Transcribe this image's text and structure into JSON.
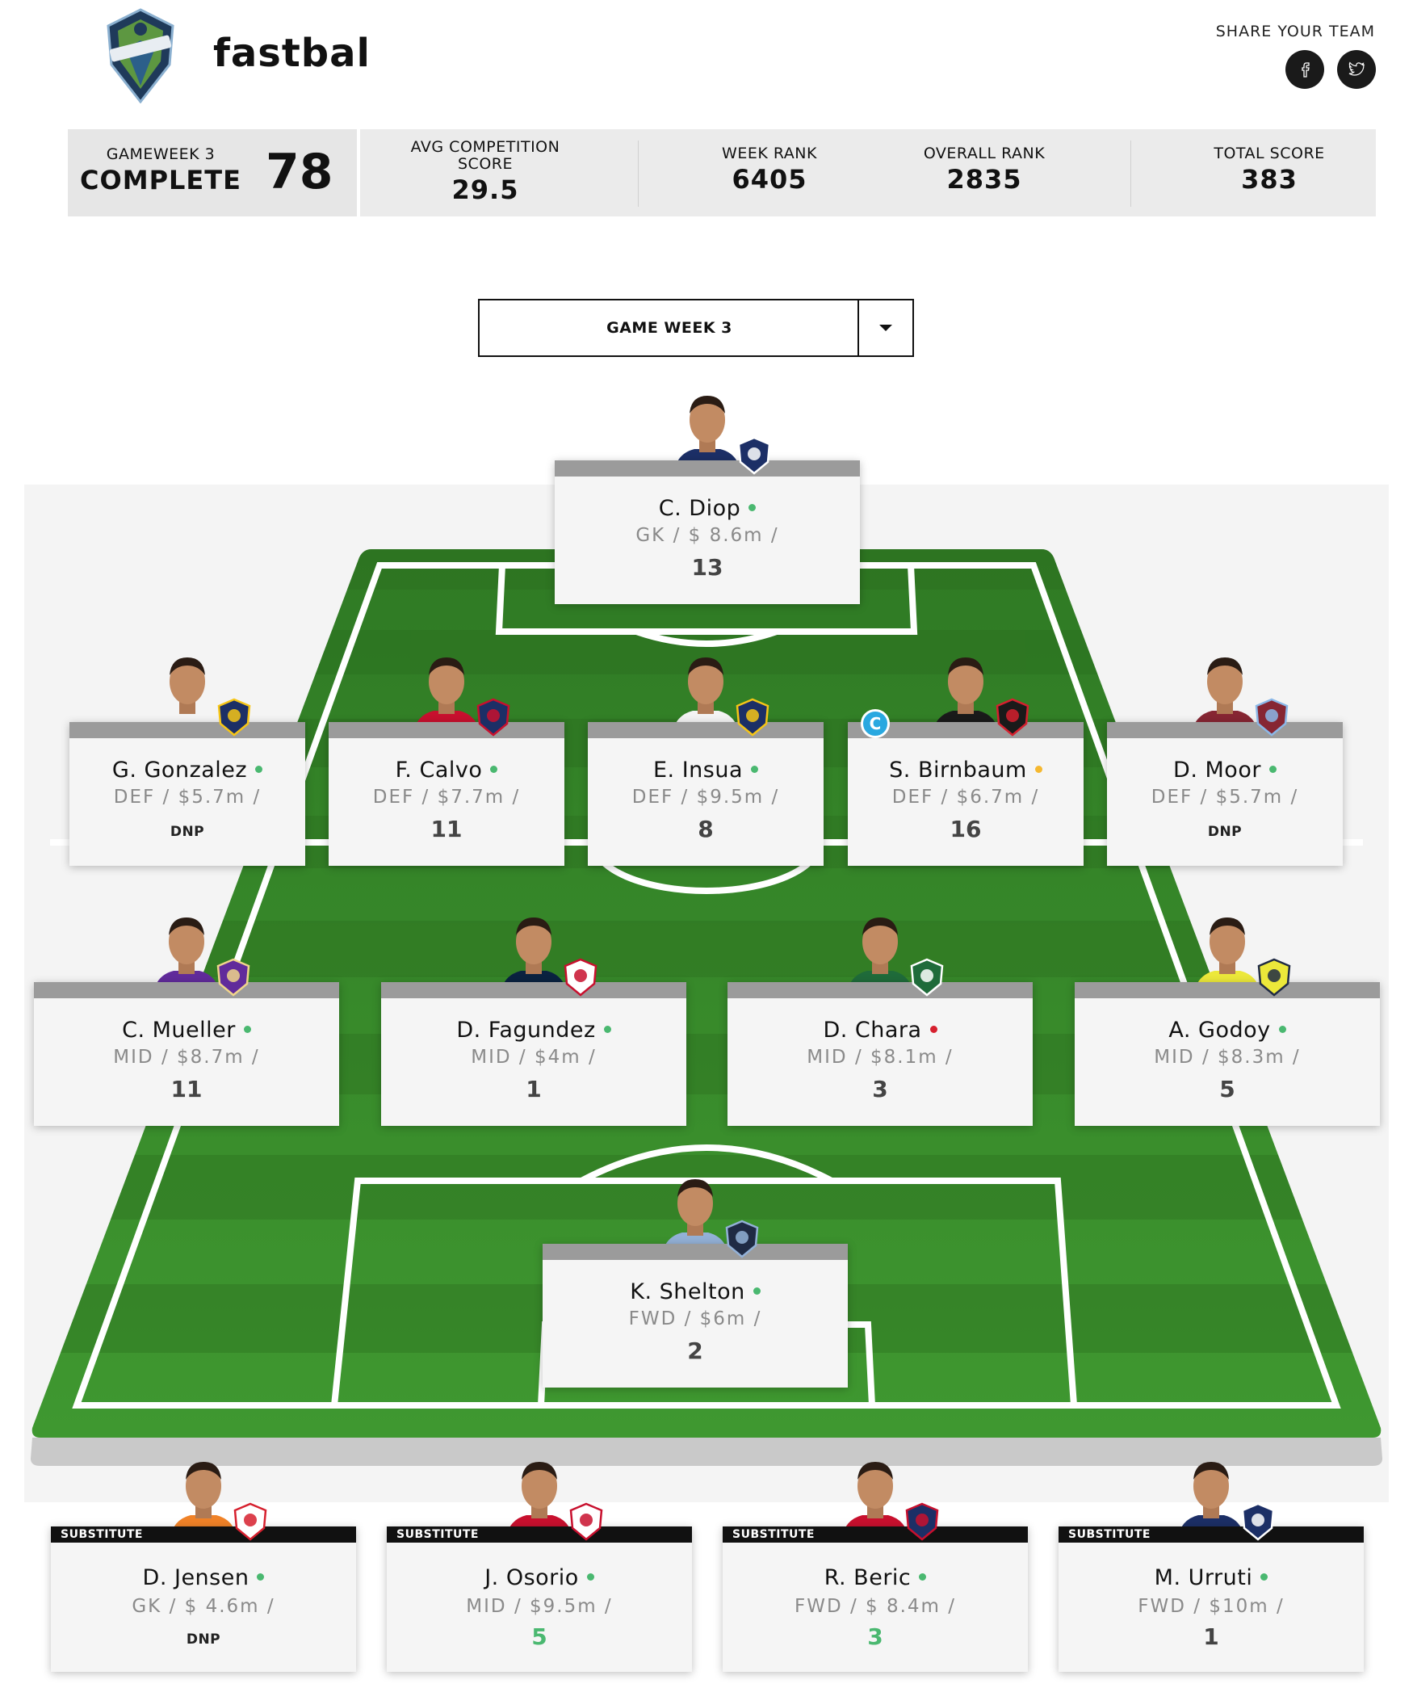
{
  "header": {
    "team_name": "fastbal",
    "share_label": "SHARE YOUR TEAM",
    "share_icons": [
      "facebook-icon",
      "twitter-icon"
    ]
  },
  "stats": {
    "gameweek_label": "GAMEWEEK 3",
    "gameweek_status": "COMPLETE",
    "gameweek_score": "78",
    "avg_label": "AVG COMPETITION SCORE",
    "avg_value": "29.5",
    "week_rank_label": "WEEK RANK",
    "week_rank_value": "6405",
    "overall_rank_label": "OVERALL RANK",
    "overall_rank_value": "2835",
    "total_score_label": "TOTAL SCORE",
    "total_score_value": "383"
  },
  "gameweek_select": {
    "selected": "GAME WEEK 3"
  },
  "colors": {
    "status_green": "#4ab870",
    "status_yellow": "#f5b830",
    "status_red": "#d6202e",
    "pitch_green": "#3c8f2e",
    "captain_blue": "#29a8e0"
  },
  "captain_mark": "C",
  "sub_label": "SUBSTITUTE",
  "players": {
    "gk": {
      "name": "C. Diop",
      "info": "GK / $ 8.6m /",
      "points": "13",
      "status": "green",
      "club": "Montreal"
    },
    "def1": {
      "name": "G. Gonzalez",
      "info": "DEF / $5.7m /",
      "points": "DNP",
      "status": "green",
      "club": "LA Galaxy"
    },
    "def2": {
      "name": "F. Calvo",
      "info": "DEF / $7.7m /",
      "points": "11",
      "status": "green",
      "club": "Chicago"
    },
    "def3": {
      "name": "E. Insua",
      "info": "DEF / $9.5m /",
      "points": "8",
      "status": "green",
      "club": "LA Galaxy"
    },
    "def4": {
      "name": "S. Birnbaum",
      "info": "DEF / $6.7m /",
      "points": "16",
      "status": "yellow",
      "club": "DC United",
      "captain": true
    },
    "def5": {
      "name": "D. Moor",
      "info": "DEF / $5.7m /",
      "points": "DNP",
      "status": "green",
      "club": "Colorado"
    },
    "mid1": {
      "name": "C. Mueller",
      "info": "MID / $8.7m /",
      "points": "11",
      "status": "green",
      "club": "Orlando City"
    },
    "mid2": {
      "name": "D. Fagundez",
      "info": "MID / $4m /",
      "points": "1",
      "status": "green",
      "club": "New England"
    },
    "mid3": {
      "name": "D. Chara",
      "info": "MID / $8.1m /",
      "points": "3",
      "status": "red",
      "club": "Portland"
    },
    "mid4": {
      "name": "A. Godoy",
      "info": "MID / $8.3m /",
      "points": "5",
      "status": "green",
      "club": "Nashville"
    },
    "fwd1": {
      "name": "K. Shelton",
      "info": "FWD / $6m /",
      "points": "2",
      "status": "green",
      "club": "Sporting KC"
    },
    "sub1": {
      "name": "D. Jensen",
      "info": "GK / $ 4.6m /",
      "points": "DNP",
      "status": "green",
      "club": "Red Bull"
    },
    "sub2": {
      "name": "J. Osorio",
      "info": "MID / $9.5m /",
      "points": "5",
      "status": "green",
      "club": "Toronto"
    },
    "sub3": {
      "name": "R. Beric",
      "info": "FWD / $ 8.4m /",
      "points": "3",
      "status": "green",
      "club": "Chicago"
    },
    "sub4": {
      "name": "M. Urruti",
      "info": "FWD / $10m /",
      "points": "1",
      "status": "green",
      "club": "Montreal"
    }
  }
}
